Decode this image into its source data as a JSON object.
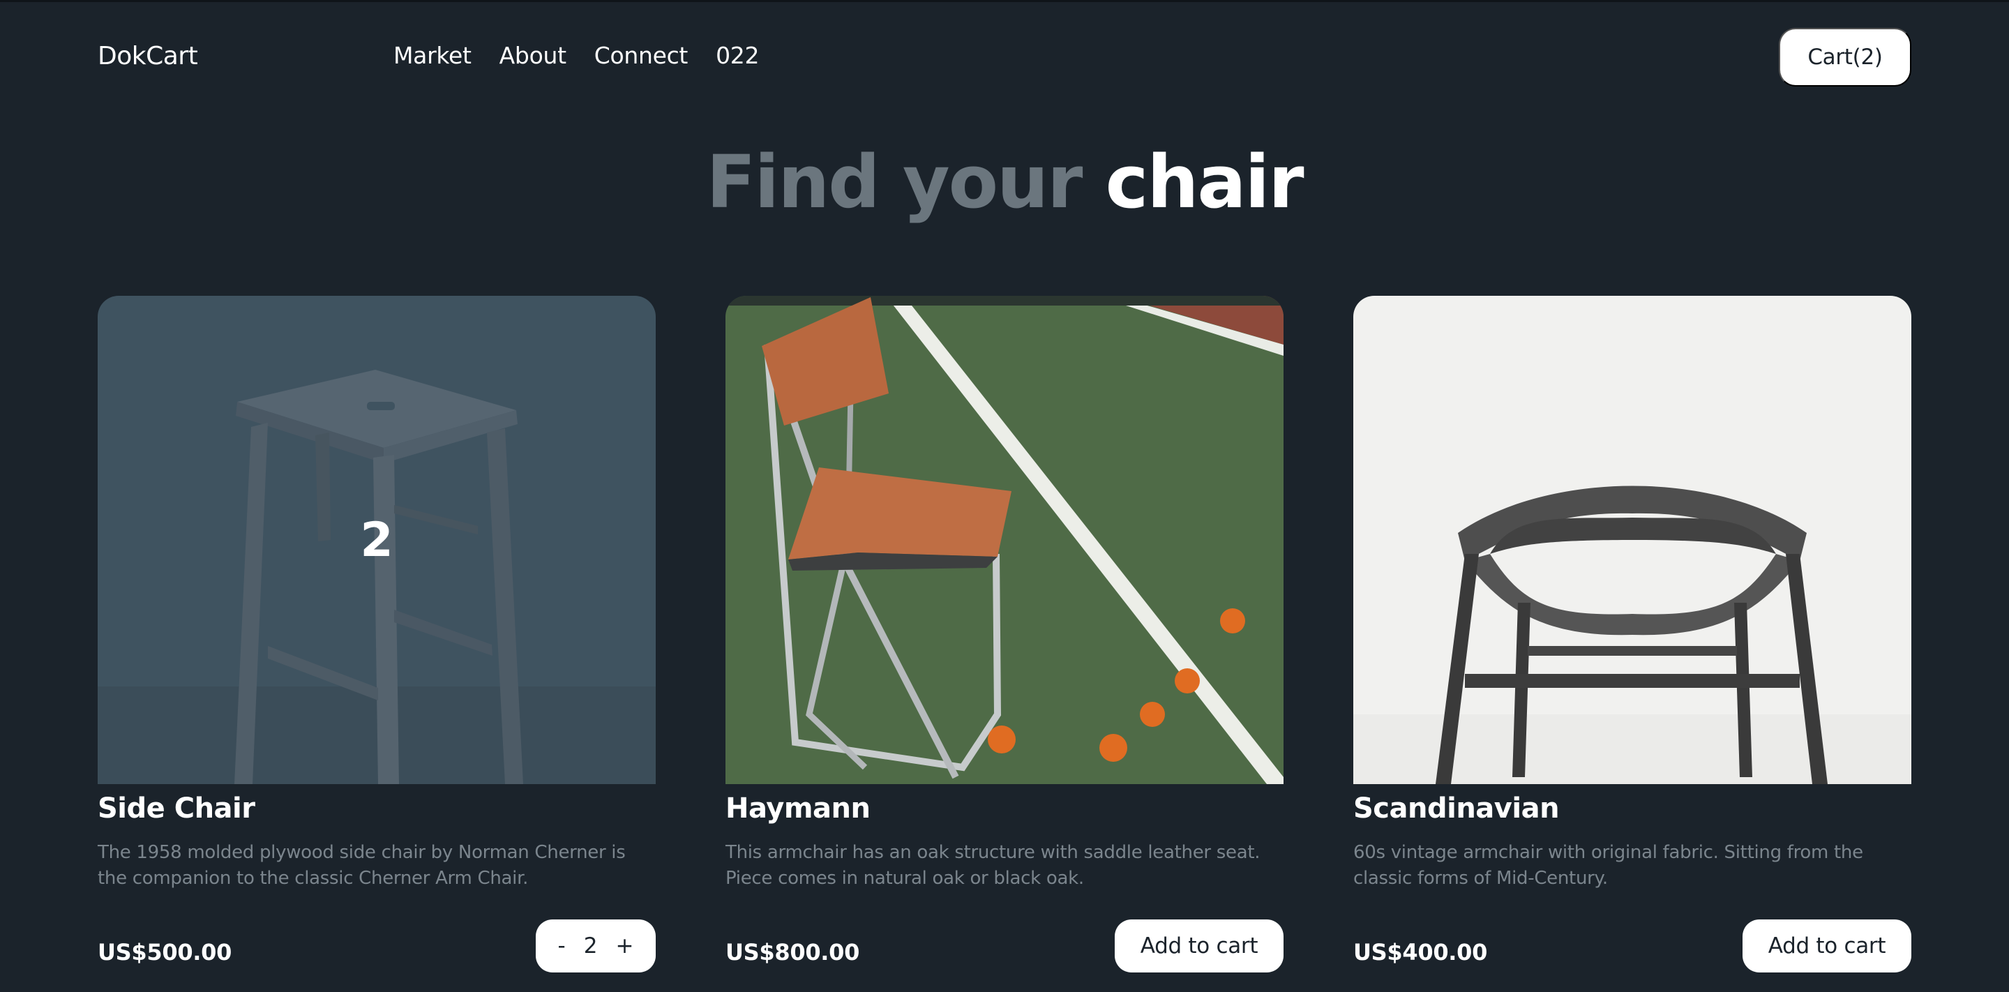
{
  "header": {
    "brand": "DokCart",
    "nav": [
      "Market",
      "About",
      "Connect",
      "022"
    ],
    "cart_label": "Cart(2)"
  },
  "hero": {
    "muted": "Find your",
    "strong": "chair"
  },
  "products": [
    {
      "name": "Side Chair",
      "description": "The 1958 molded plywood side chair by Norman Cherner is the companion to the classic Cherner Arm Chair.",
      "price": "US$500.00",
      "in_cart_quantity": "2",
      "stepper": {
        "minus": "-",
        "value": "2",
        "plus": "+"
      }
    },
    {
      "name": "Haymann",
      "description": "This armchair has an oak structure with saddle leather seat. Piece comes in natural oak or black oak.",
      "price": "US$800.00",
      "button_label": "Add to cart"
    },
    {
      "name": "Scandinavian",
      "description": "60s vintage armchair with original fabric. Sitting from the classic forms of Mid-Century.",
      "price": "US$400.00",
      "button_label": "Add to cart"
    }
  ],
  "colors": {
    "background": "#1b232b",
    "muted_text": "#6b767e",
    "button_bg": "#ffffff"
  }
}
